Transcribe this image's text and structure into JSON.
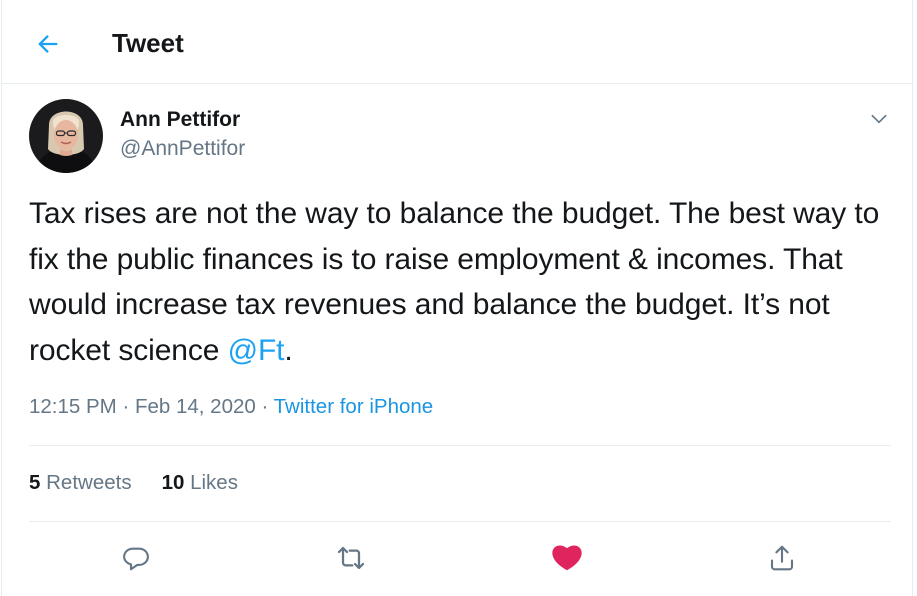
{
  "header": {
    "title": "Tweet",
    "back_icon": "arrow-left-icon"
  },
  "author": {
    "name": "Ann Pettifor",
    "handle": "@AnnPettifor"
  },
  "tweet": {
    "text_before_mention": "Tax rises are not the way to balance the budget. The best way to fix the public finances is to raise employment & incomes. That would increase tax revenues and balance the budget. It’s not rocket science ",
    "mention": "@Ft",
    "text_after_mention": "."
  },
  "meta": {
    "time": "12:15 PM",
    "separator1": " · ",
    "date": "Feb 14, 2020",
    "separator2": " · ",
    "source": "Twitter for iPhone"
  },
  "stats": {
    "retweets_count": "5",
    "retweets_label": "Retweets",
    "likes_count": "10",
    "likes_label": "Likes"
  },
  "actions": {
    "reply_icon": "reply-icon",
    "retweet_icon": "retweet-icon",
    "like_icon": "heart-icon",
    "share_icon": "share-icon"
  },
  "colors": {
    "accent": "#1da1f2",
    "like": "#e0245e",
    "muted": "#657786",
    "text": "#14171a",
    "border": "#e6ecf0"
  }
}
